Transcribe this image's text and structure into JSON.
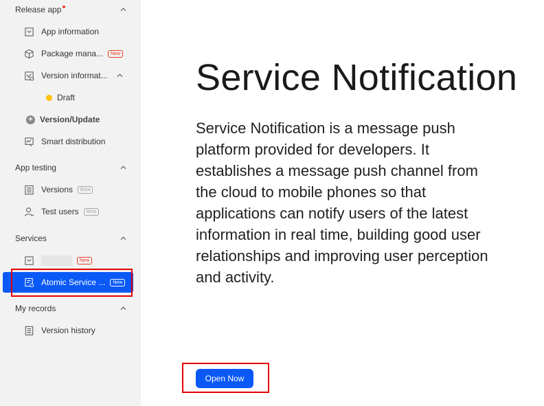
{
  "sidebar": {
    "sections": [
      {
        "title": "Release app",
        "has_dot": true
      },
      {
        "title": "App testing"
      },
      {
        "title": "Services"
      },
      {
        "title": "My records"
      }
    ],
    "items": {
      "app_information": "App information",
      "package_management": "Package mana...",
      "package_badge": "New",
      "version_information": "Version informat...",
      "draft": "Draft",
      "version_update": "Version/Update",
      "smart_distribution": "Smart distribution",
      "versions": "Versions",
      "versions_badge": "Beta",
      "test_users": "Test users",
      "test_users_badge": "Beta",
      "services_blank_badge": "New",
      "atomic_service": "Atomic Service ...",
      "atomic_badge": "New",
      "version_history": "Version history"
    }
  },
  "main": {
    "title": "Service Notification",
    "description": "Service Notification is a message push platform provided for developers. It establishes a message push channel from the cloud to mobile phones so that applications can notify users of the latest information in real time, building good user relationships and improving user perception and activity.",
    "open_button": "Open Now"
  },
  "colors": {
    "accent": "#0a59f7",
    "sidebar_bg": "#f2f2f3",
    "badge_red": "#e84026",
    "draft_dot": "#ffbf00",
    "highlight_box": "#e40000"
  }
}
